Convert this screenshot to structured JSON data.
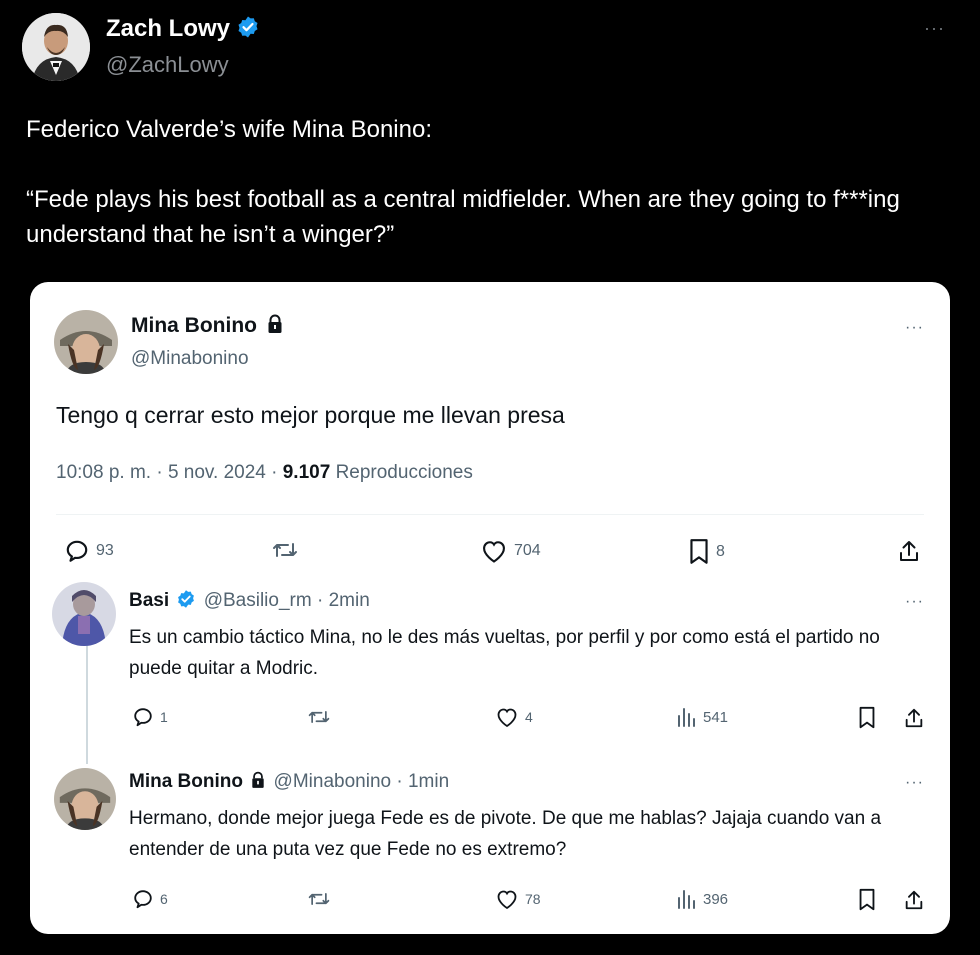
{
  "outer_tweet": {
    "author_name": "Zach Lowy",
    "author_handle": "@ZachLowy",
    "more": "···",
    "text_line1": "Federico Valverde’s wife Mina Bonino:",
    "text_quote": "“Fede plays his best football as a central midfielder. When are they going to f***ing understand that he isn’t a winger?”"
  },
  "embedded": {
    "main_tweet": {
      "author_name": "Mina Bonino",
      "author_handle": "@Minabonino",
      "more": "···",
      "text": "Tengo q cerrar esto mejor porque me llevan presa",
      "time": "10:08 p. m. · 5 nov. 2024 ·",
      "views_count": "9.107",
      "views_label": "Reproducciones",
      "replies": "93",
      "likes": "704",
      "bookmarks": "8"
    },
    "reply1": {
      "author_name": "Basi",
      "author_handle": "@Basilio_rm",
      "time": "· 2min",
      "more": "···",
      "text": "Es un cambio táctico Mina, no le des más vueltas, por perfil y por como está el partido no puede quitar a Modric.",
      "replies": "1",
      "likes": "4",
      "views": "541"
    },
    "reply2": {
      "author_name": "Mina Bonino",
      "author_handle": "@Minabonino",
      "time": "· 1min",
      "more": "···",
      "text": "Hermano, donde mejor juega Fede es de pivote. De que me hablas? Jajaja cuando van a entender de una puta vez que Fede no es extremo?",
      "replies": "6",
      "likes": "78",
      "views": "396"
    }
  },
  "colors": {
    "verified_blue": "#1d9bf0",
    "muted_gray": "#536471",
    "background": "#000000",
    "card": "#ffffff"
  },
  "icons": [
    "verified-badge-icon",
    "lock-icon",
    "reply-icon",
    "retweet-icon",
    "like-icon",
    "bookmark-icon",
    "share-icon",
    "views-icon",
    "more-icon"
  ]
}
